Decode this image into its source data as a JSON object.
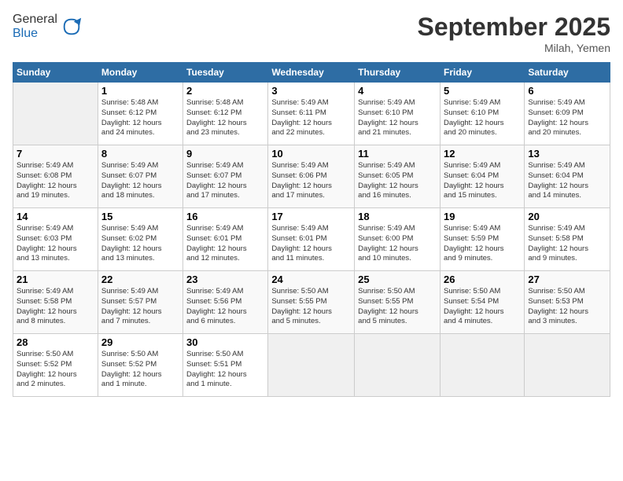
{
  "header": {
    "logo_line1": "General",
    "logo_line2": "Blue",
    "month": "September 2025",
    "location": "Milah, Yemen"
  },
  "columns": [
    "Sunday",
    "Monday",
    "Tuesday",
    "Wednesday",
    "Thursday",
    "Friday",
    "Saturday"
  ],
  "weeks": [
    [
      {
        "day": "",
        "info": ""
      },
      {
        "day": "1",
        "info": "Sunrise: 5:48 AM\nSunset: 6:12 PM\nDaylight: 12 hours\nand 24 minutes."
      },
      {
        "day": "2",
        "info": "Sunrise: 5:48 AM\nSunset: 6:12 PM\nDaylight: 12 hours\nand 23 minutes."
      },
      {
        "day": "3",
        "info": "Sunrise: 5:49 AM\nSunset: 6:11 PM\nDaylight: 12 hours\nand 22 minutes."
      },
      {
        "day": "4",
        "info": "Sunrise: 5:49 AM\nSunset: 6:10 PM\nDaylight: 12 hours\nand 21 minutes."
      },
      {
        "day": "5",
        "info": "Sunrise: 5:49 AM\nSunset: 6:10 PM\nDaylight: 12 hours\nand 20 minutes."
      },
      {
        "day": "6",
        "info": "Sunrise: 5:49 AM\nSunset: 6:09 PM\nDaylight: 12 hours\nand 20 minutes."
      }
    ],
    [
      {
        "day": "7",
        "info": "Sunrise: 5:49 AM\nSunset: 6:08 PM\nDaylight: 12 hours\nand 19 minutes."
      },
      {
        "day": "8",
        "info": "Sunrise: 5:49 AM\nSunset: 6:07 PM\nDaylight: 12 hours\nand 18 minutes."
      },
      {
        "day": "9",
        "info": "Sunrise: 5:49 AM\nSunset: 6:07 PM\nDaylight: 12 hours\nand 17 minutes."
      },
      {
        "day": "10",
        "info": "Sunrise: 5:49 AM\nSunset: 6:06 PM\nDaylight: 12 hours\nand 17 minutes."
      },
      {
        "day": "11",
        "info": "Sunrise: 5:49 AM\nSunset: 6:05 PM\nDaylight: 12 hours\nand 16 minutes."
      },
      {
        "day": "12",
        "info": "Sunrise: 5:49 AM\nSunset: 6:04 PM\nDaylight: 12 hours\nand 15 minutes."
      },
      {
        "day": "13",
        "info": "Sunrise: 5:49 AM\nSunset: 6:04 PM\nDaylight: 12 hours\nand 14 minutes."
      }
    ],
    [
      {
        "day": "14",
        "info": "Sunrise: 5:49 AM\nSunset: 6:03 PM\nDaylight: 12 hours\nand 13 minutes."
      },
      {
        "day": "15",
        "info": "Sunrise: 5:49 AM\nSunset: 6:02 PM\nDaylight: 12 hours\nand 13 minutes."
      },
      {
        "day": "16",
        "info": "Sunrise: 5:49 AM\nSunset: 6:01 PM\nDaylight: 12 hours\nand 12 minutes."
      },
      {
        "day": "17",
        "info": "Sunrise: 5:49 AM\nSunset: 6:01 PM\nDaylight: 12 hours\nand 11 minutes."
      },
      {
        "day": "18",
        "info": "Sunrise: 5:49 AM\nSunset: 6:00 PM\nDaylight: 12 hours\nand 10 minutes."
      },
      {
        "day": "19",
        "info": "Sunrise: 5:49 AM\nSunset: 5:59 PM\nDaylight: 12 hours\nand 9 minutes."
      },
      {
        "day": "20",
        "info": "Sunrise: 5:49 AM\nSunset: 5:58 PM\nDaylight: 12 hours\nand 9 minutes."
      }
    ],
    [
      {
        "day": "21",
        "info": "Sunrise: 5:49 AM\nSunset: 5:58 PM\nDaylight: 12 hours\nand 8 minutes."
      },
      {
        "day": "22",
        "info": "Sunrise: 5:49 AM\nSunset: 5:57 PM\nDaylight: 12 hours\nand 7 minutes."
      },
      {
        "day": "23",
        "info": "Sunrise: 5:49 AM\nSunset: 5:56 PM\nDaylight: 12 hours\nand 6 minutes."
      },
      {
        "day": "24",
        "info": "Sunrise: 5:50 AM\nSunset: 5:55 PM\nDaylight: 12 hours\nand 5 minutes."
      },
      {
        "day": "25",
        "info": "Sunrise: 5:50 AM\nSunset: 5:55 PM\nDaylight: 12 hours\nand 5 minutes."
      },
      {
        "day": "26",
        "info": "Sunrise: 5:50 AM\nSunset: 5:54 PM\nDaylight: 12 hours\nand 4 minutes."
      },
      {
        "day": "27",
        "info": "Sunrise: 5:50 AM\nSunset: 5:53 PM\nDaylight: 12 hours\nand 3 minutes."
      }
    ],
    [
      {
        "day": "28",
        "info": "Sunrise: 5:50 AM\nSunset: 5:52 PM\nDaylight: 12 hours\nand 2 minutes."
      },
      {
        "day": "29",
        "info": "Sunrise: 5:50 AM\nSunset: 5:52 PM\nDaylight: 12 hours\nand 1 minute."
      },
      {
        "day": "30",
        "info": "Sunrise: 5:50 AM\nSunset: 5:51 PM\nDaylight: 12 hours\nand 1 minute."
      },
      {
        "day": "",
        "info": ""
      },
      {
        "day": "",
        "info": ""
      },
      {
        "day": "",
        "info": ""
      },
      {
        "day": "",
        "info": ""
      }
    ]
  ]
}
